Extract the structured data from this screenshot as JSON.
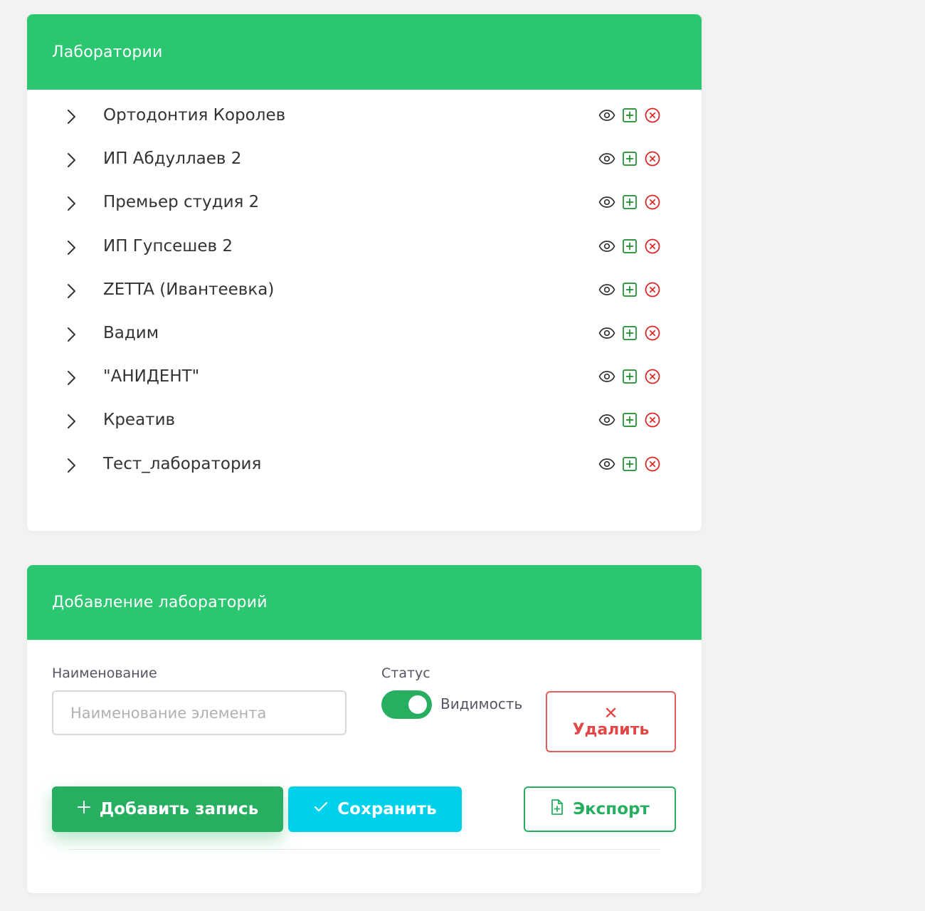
{
  "labs_panel": {
    "title": "Лаборатории",
    "items": [
      {
        "label": "Ортодонтия Королев"
      },
      {
        "label": "ИП Абдуллаев 2"
      },
      {
        "label": "Премьер студия 2"
      },
      {
        "label": "ИП Гупсешев 2"
      },
      {
        "label": "ZETTA (Ивантеевка)"
      },
      {
        "label": "Вадим"
      },
      {
        "label": "\"АНИДЕНТ\""
      },
      {
        "label": "Креатив"
      },
      {
        "label": "Тест_лаборатория"
      }
    ],
    "row_actions": {
      "expand_icon": "chevron-right-icon",
      "view_icon": "eye-icon",
      "add_icon": "plus-square-icon",
      "delete_icon": "x-circle-icon"
    }
  },
  "add_panel": {
    "title": "Добавление лабораторий",
    "name_label": "Наименование",
    "name_placeholder": "Наименование элемента",
    "name_value": "",
    "status_label": "Статус",
    "visibility_label": "Видимость",
    "visibility_on": true,
    "delete_button": "Удалить",
    "add_button": "Добавить запись",
    "save_button": "Сохранить",
    "export_button": "Экспорт"
  },
  "colors": {
    "header_green": "#2bc770",
    "primary_green": "#27ae60",
    "cyan": "#00d0ea",
    "danger_red": "#e04848",
    "icon_green": "#1a8c2a"
  }
}
